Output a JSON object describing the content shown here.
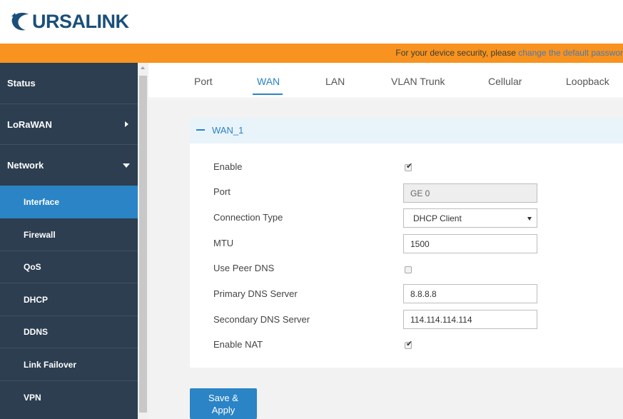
{
  "brand": {
    "logo_text": "URSALINK",
    "logo_icon": "ursalink-bear-icon",
    "logo_color": "#1a4f7a"
  },
  "security_bar": {
    "text": "For your device security, please ",
    "link_text": "change the default passwor",
    "bg_color": "#f7931e"
  },
  "sidebar": {
    "items": [
      {
        "label": "Status"
      },
      {
        "label": "LoRaWAN",
        "icon": "chevron-right-icon"
      },
      {
        "label": "Network",
        "icon": "chevron-down-icon"
      },
      {
        "label": "Interface",
        "active": true
      },
      {
        "label": "Firewall"
      },
      {
        "label": "QoS"
      },
      {
        "label": "DHCP"
      },
      {
        "label": "DDNS"
      },
      {
        "label": "Link Failover"
      },
      {
        "label": "VPN"
      }
    ],
    "bg_color": "#2c3e50",
    "active_color": "#2a84c6"
  },
  "tabs": [
    {
      "label": "Port"
    },
    {
      "label": "WAN",
      "active": true
    },
    {
      "label": "LAN"
    },
    {
      "label": "VLAN Trunk"
    },
    {
      "label": "Cellular"
    },
    {
      "label": "Loopback"
    }
  ],
  "panel": {
    "title": "WAN_1",
    "collapse_icon": "minus-icon",
    "fields": {
      "enable": {
        "label": "Enable",
        "checked": true
      },
      "port": {
        "label": "Port",
        "value": "GE 0"
      },
      "connection_type": {
        "label": "Connection Type",
        "value": "DHCP Client"
      },
      "mtu": {
        "label": "MTU",
        "value": "1500"
      },
      "use_peer_dns": {
        "label": "Use Peer DNS",
        "checked": false
      },
      "primary_dns": {
        "label": "Primary DNS Server",
        "value": "8.8.8.8"
      },
      "secondary_dns": {
        "label": "Secondary DNS Server",
        "value": "114.114.114.114"
      },
      "enable_nat": {
        "label": "Enable NAT",
        "checked": true
      }
    }
  },
  "actions": {
    "save_line1": "Save &",
    "save_line2": "Apply"
  },
  "glyphs": {
    "checkmark": "✔"
  }
}
